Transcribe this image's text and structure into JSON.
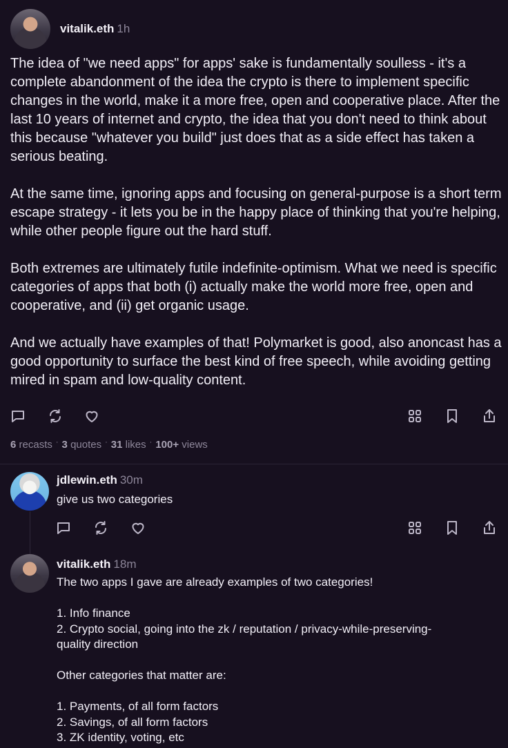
{
  "main_post": {
    "username": "vitalik.eth",
    "time": "1h",
    "paragraphs": [
      "The idea of \"we need apps\" for apps' sake is fundamentally soulless - it's a complete abandonment of the idea the crypto is there to implement specific changes in the world, make it a more free, open and cooperative place. After the last 10 years of internet and crypto, the idea that you don't need to think about this because \"whatever you build\" just does that as a side effect has taken a serious beating.",
      "At the same time, ignoring apps and focusing on general-purpose is a short term escape strategy - it lets you be in the happy place of thinking that you're helping, while other people figure out the hard stuff.",
      "Both extremes are ultimately futile indefinite-optimism. What we need is specific categories of apps that both (i) actually make the world more free, open and cooperative, and (ii) get organic usage.",
      "And we actually have examples of that! Polymarket is good, also anoncast has a good opportunity to surface the best kind of free speech, while avoiding getting mired in spam and low-quality content."
    ],
    "stats": {
      "recasts_count": "6",
      "recasts_label": "recasts",
      "quotes_count": "3",
      "quotes_label": "quotes",
      "likes_count": "31",
      "likes_label": "likes",
      "views_count": "100+",
      "views_label": "views",
      "separator": "·"
    }
  },
  "replies": [
    {
      "username": "jdlewin.eth",
      "time": "30m",
      "text": "give us two categories"
    },
    {
      "username": "vitalik.eth",
      "time": "18m",
      "lines": [
        "The two apps I gave are already examples of two categories!",
        "",
        "1. Info finance",
        "2. Crypto social, going into the zk / reputation / privacy-while-preserving-",
        "quality direction",
        "",
        "Other categories that matter are:",
        "",
        "1. Payments, of all form factors",
        "2. Savings, of all form factors",
        "3. ZK identity, voting, etc"
      ]
    }
  ],
  "icons": {
    "reply": "comment-icon",
    "recast": "recast-icon",
    "like": "heart-icon",
    "apps": "grid-icon",
    "bookmark": "bookmark-icon",
    "share": "share-icon"
  },
  "colors": {
    "background": "#17101f",
    "text": "#f2eff7",
    "muted": "#8d8699",
    "icon": "#bdb7c8"
  }
}
